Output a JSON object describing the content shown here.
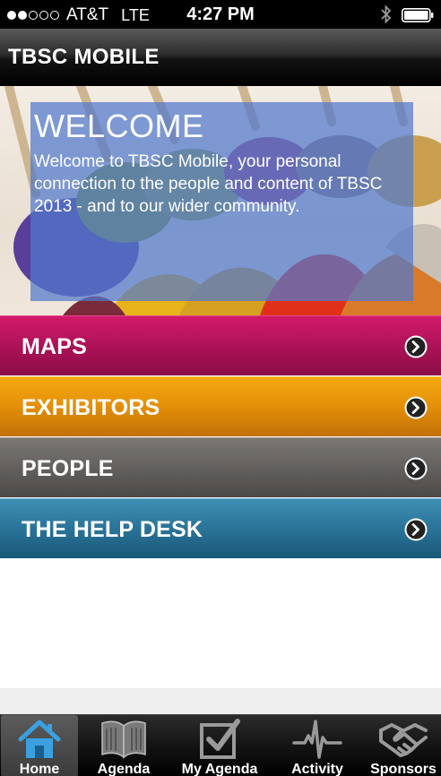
{
  "status_bar": {
    "carrier": "AT&T",
    "network": "LTE",
    "time": "4:27 PM",
    "signal_bars": 2,
    "signal_total": 5
  },
  "navbar": {
    "title": "TBSC MOBILE"
  },
  "welcome": {
    "title": "WELCOME",
    "text": "Welcome to TBSC Mobile, your personal connection to the people and content of TBSC 2013 - and to our wider community."
  },
  "menu": {
    "items": [
      {
        "label": "MAPS",
        "color": "#ad1257"
      },
      {
        "label": "EXHIBITORS",
        "color": "#e38f09"
      },
      {
        "label": "PEOPLE",
        "color": "#63605e"
      },
      {
        "label": "THE HELP DESK",
        "color": "#2a7398"
      }
    ],
    "chevron_icon": "chevron-right-circle-icon"
  },
  "tabbar": {
    "tabs": [
      {
        "label": "Home",
        "icon": "home-icon",
        "active": true
      },
      {
        "label": "Agenda",
        "icon": "book-icon",
        "active": false
      },
      {
        "label": "My Agenda",
        "icon": "checkbox-icon",
        "active": false
      },
      {
        "label": "Activity",
        "icon": "heartbeat-icon",
        "active": false
      },
      {
        "label": "Sponsors",
        "icon": "handshake-icon",
        "active": false
      }
    ]
  },
  "colors": {
    "accent_home": "#3aa0e0",
    "welcome_overlay": "#5078cd"
  }
}
